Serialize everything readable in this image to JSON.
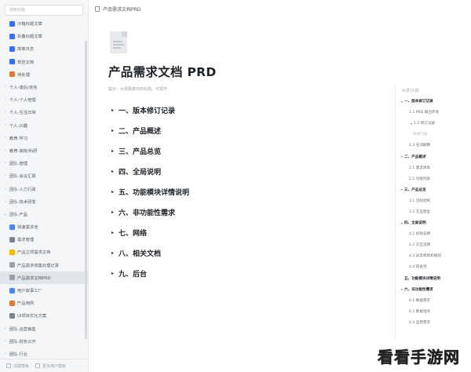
{
  "sidebar": {
    "search_placeholder": "搜索标题",
    "items": [
      {
        "label": "沙箱标题文章",
        "icon": "doc-blue-icon",
        "color": "#3370ff",
        "level": 1,
        "chev": ""
      },
      {
        "label": "折叠标题文章",
        "icon": "doc-blue-icon",
        "color": "#3370ff",
        "level": 1,
        "chev": ""
      },
      {
        "label": "简单日志",
        "icon": "doc-blue-icon",
        "color": "#3370ff",
        "level": 1,
        "chev": ""
      },
      {
        "label": "规范文档",
        "icon": "doc-blue-icon",
        "color": "#3370ff",
        "level": 1,
        "chev": ""
      },
      {
        "label": "待处理",
        "icon": "gear-orange-icon",
        "color": "#d97a3a",
        "level": 1,
        "chev": ""
      },
      {
        "label": "个人-落后/走完",
        "icon": "",
        "color": "",
        "level": 0,
        "chev": "›"
      },
      {
        "label": "个人-个人管理",
        "icon": "",
        "color": "",
        "level": 0,
        "chev": "›"
      },
      {
        "label": "个人-生活日常",
        "icon": "",
        "color": "",
        "level": 0,
        "chev": "›"
      },
      {
        "label": "个人-兴趣",
        "icon": "",
        "color": "",
        "level": 0,
        "chev": "›"
      },
      {
        "label": "教育-学习",
        "icon": "",
        "color": "",
        "level": 0,
        "chev": "›"
      },
      {
        "label": "教育-高校/科研",
        "icon": "",
        "color": "",
        "level": 0,
        "chev": "›"
      },
      {
        "label": "团队-管理",
        "icon": "",
        "color": "",
        "level": 0,
        "chev": "›"
      },
      {
        "label": "团队-会议汇报",
        "icon": "",
        "color": "",
        "level": 0,
        "chev": "›"
      },
      {
        "label": "团队-人力行政",
        "icon": "",
        "color": "",
        "level": 0,
        "chev": "›"
      },
      {
        "label": "团队-技术研发",
        "icon": "",
        "color": "",
        "level": 0,
        "chev": "›"
      },
      {
        "label": "团队-产品",
        "icon": "",
        "color": "",
        "level": 0,
        "chev": "⌄"
      },
      {
        "label": "快速需求池",
        "icon": "doc-blue-icon",
        "color": "#4e83fd",
        "level": 1,
        "chev": ""
      },
      {
        "label": "需求管理",
        "icon": "clipboard-icon",
        "color": "#7a8390",
        "level": 1,
        "chev": ""
      },
      {
        "label": "产品立项需求文档",
        "icon": "star-icon",
        "color": "#f5b800",
        "level": 1,
        "chev": ""
      },
      {
        "label": "产品需求收集处理记录",
        "icon": "doc-gray-icon",
        "color": "#9aa1aa",
        "level": 1,
        "chev": ""
      },
      {
        "label": "产品需求文档PRD",
        "icon": "doc-gray-icon",
        "color": "#9aa1aa",
        "level": 1,
        "chev": "",
        "active": true
      },
      {
        "label": "用户故事工厂",
        "icon": "factory-icon",
        "color": "#4e83fd",
        "level": 1,
        "chev": ""
      },
      {
        "label": "产品用例",
        "icon": "case-orange-icon",
        "color": "#e07a36",
        "level": 1,
        "chev": ""
      },
      {
        "label": "UI项目优化方案",
        "icon": "rocket-icon",
        "color": "#7a8390",
        "level": 1,
        "chev": ""
      },
      {
        "label": "团队-运营销售",
        "icon": "",
        "color": "",
        "level": 0,
        "chev": "›"
      },
      {
        "label": "团队-财务公开",
        "icon": "",
        "color": "",
        "level": 0,
        "chev": "›"
      },
      {
        "label": "团队-行业",
        "icon": "",
        "color": "",
        "level": 0,
        "chev": "›"
      }
    ],
    "footer": {
      "left": "创建模板",
      "right": "更多用户模板"
    }
  },
  "topbar": {
    "breadcrumb": "产品需求文档PRD"
  },
  "doc": {
    "title": "产品需求文档 PRD",
    "hint": "提示：大纲跟着你的标题，可展开",
    "sections": [
      "一、版本修订记录",
      "二、产品概述",
      "三、产品总览",
      "四、全局说明",
      "五、功能模块详情说明",
      "六、非功能性需求",
      "七、网络",
      "八、相关文档",
      "九、后台"
    ]
  },
  "outline": {
    "title": "目录/大纲",
    "items": [
      {
        "label": "一、版本修订记录",
        "level": 0,
        "chev": "▾"
      },
      {
        "label": "1.1 PRD 输出环境",
        "level": 1,
        "chev": ""
      },
      {
        "label": "1.2 修订记录",
        "level": 1,
        "chev": "▾"
      },
      {
        "label": "修改内容",
        "level": 2,
        "chev": ""
      },
      {
        "label": "1.3 名词解释",
        "level": 1,
        "chev": ""
      },
      {
        "label": "二、产品概述",
        "level": 0,
        "chev": "▾"
      },
      {
        "label": "2.1 需求清单",
        "level": 1,
        "chev": ""
      },
      {
        "label": "2.2 功能列表",
        "level": 1,
        "chev": ""
      },
      {
        "label": "三、产品总览",
        "level": 0,
        "chev": "▾"
      },
      {
        "label": "3.1 流程结构",
        "level": 1,
        "chev": ""
      },
      {
        "label": "3.2 交互原型",
        "level": 1,
        "chev": ""
      },
      {
        "label": "四、全局说明",
        "level": 0,
        "chev": "▾"
      },
      {
        "label": "4.1 权限说明",
        "level": 1,
        "chev": ""
      },
      {
        "label": "4.2 交互说明",
        "level": 1,
        "chev": ""
      },
      {
        "label": "4.3 异常机制和规则",
        "level": 1,
        "chev": ""
      },
      {
        "label": "4.4 缺省页",
        "level": 1,
        "chev": ""
      },
      {
        "label": "五、功能模块详情说明",
        "level": "plain",
        "chev": ""
      },
      {
        "label": "六、非功能性需求",
        "level": 0,
        "chev": "▾"
      },
      {
        "label": "6.1 数据需求",
        "level": 1,
        "chev": ""
      },
      {
        "label": "6.2 数据埋点",
        "level": 1,
        "chev": ""
      },
      {
        "label": "6.3 运营需求",
        "level": 1,
        "chev": ""
      }
    ]
  },
  "watermark": "看看手游网"
}
